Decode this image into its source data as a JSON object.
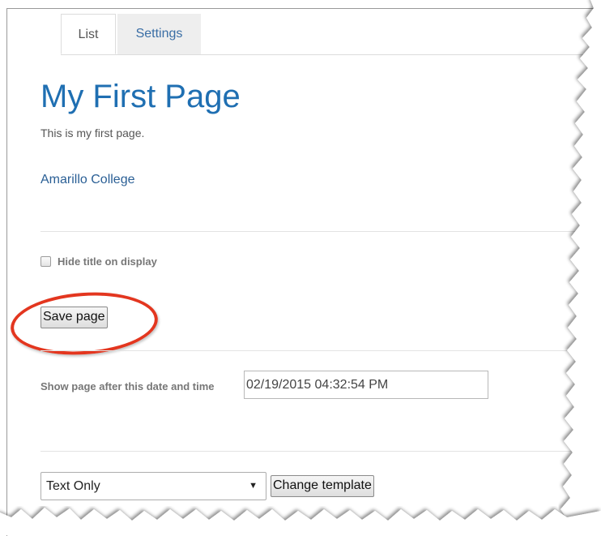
{
  "tabs": [
    {
      "label": "List",
      "active": true
    },
    {
      "label": "Settings",
      "active": false
    }
  ],
  "page": {
    "title": "My First Page",
    "intro": "This is my first page.",
    "link": "Amarillo College"
  },
  "options": {
    "hide_title_label": "Hide title on display",
    "hide_title_checked": false,
    "save_label": "Save page",
    "date_label": "Show page after this date and time",
    "date_value": "02/19/2015 04:32:54 PM"
  },
  "template": {
    "selected": "Text Only",
    "change_label": "Change template"
  },
  "colors": {
    "title": "#1f6fb2",
    "link": "#2a5f95",
    "highlight_circle": "#e3361f"
  }
}
